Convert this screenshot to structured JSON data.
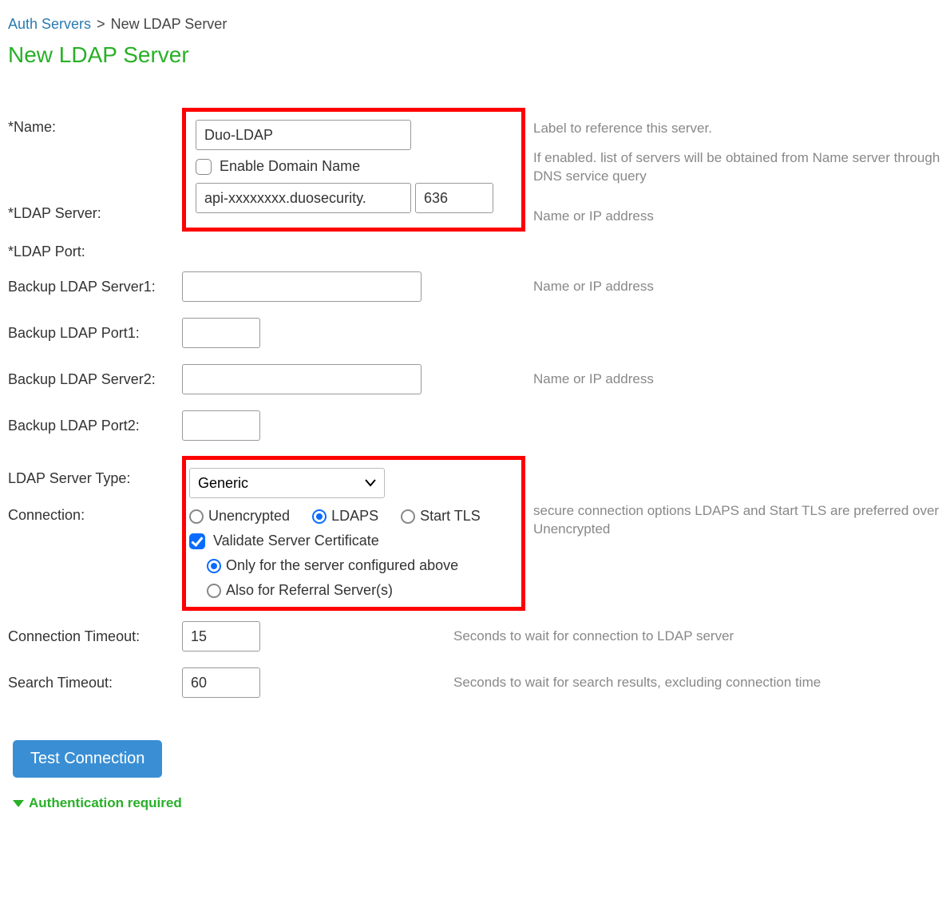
{
  "breadcrumb": {
    "parent": "Auth Servers",
    "sep": ">",
    "current": "New LDAP Server"
  },
  "title": "New LDAP Server",
  "fields": {
    "name": {
      "label": "*Name:",
      "value": "Duo-LDAP",
      "hint": "Label to reference this server."
    },
    "enable_domain": {
      "label": "Enable Domain Name",
      "checked": false,
      "hint": "If enabled. list of servers will be obtained from Name server through DNS service query"
    },
    "ldap_server": {
      "label": "*LDAP Server:",
      "value": "api-xxxxxxxx.duosecurity.",
      "hint": "Name or IP address"
    },
    "ldap_port": {
      "label": "*LDAP Port:",
      "value": "636"
    },
    "backup1_server": {
      "label": "Backup LDAP Server1:",
      "value": "",
      "hint": "Name or IP address"
    },
    "backup1_port": {
      "label": "Backup LDAP Port1:",
      "value": ""
    },
    "backup2_server": {
      "label": "Backup LDAP Server2:",
      "value": "",
      "hint": "Name or IP address"
    },
    "backup2_port": {
      "label": "Backup LDAP Port2:",
      "value": ""
    },
    "server_type": {
      "label": "LDAP Server Type:",
      "value": "Generic"
    },
    "connection": {
      "label": "Connection:",
      "options": {
        "unencrypted": "Unencrypted",
        "ldaps": "LDAPS",
        "starttls": "Start TLS"
      },
      "selected": "ldaps",
      "validate": {
        "label": "Validate Server Certificate",
        "checked": true
      },
      "scope": {
        "only": "Only for the server configured above",
        "also": "Also for Referral Server(s)",
        "selected": "only"
      },
      "hint": "secure connection options LDAPS and Start TLS are preferred over Unencrypted"
    },
    "conn_timeout": {
      "label": "Connection Timeout:",
      "value": "15",
      "hint": "Seconds to wait for connection to LDAP server"
    },
    "search_timeout": {
      "label": "Search Timeout:",
      "value": "60",
      "hint": "Seconds to wait for search results, excluding connection time"
    }
  },
  "test_button": "Test Connection",
  "section": "Authentication required"
}
